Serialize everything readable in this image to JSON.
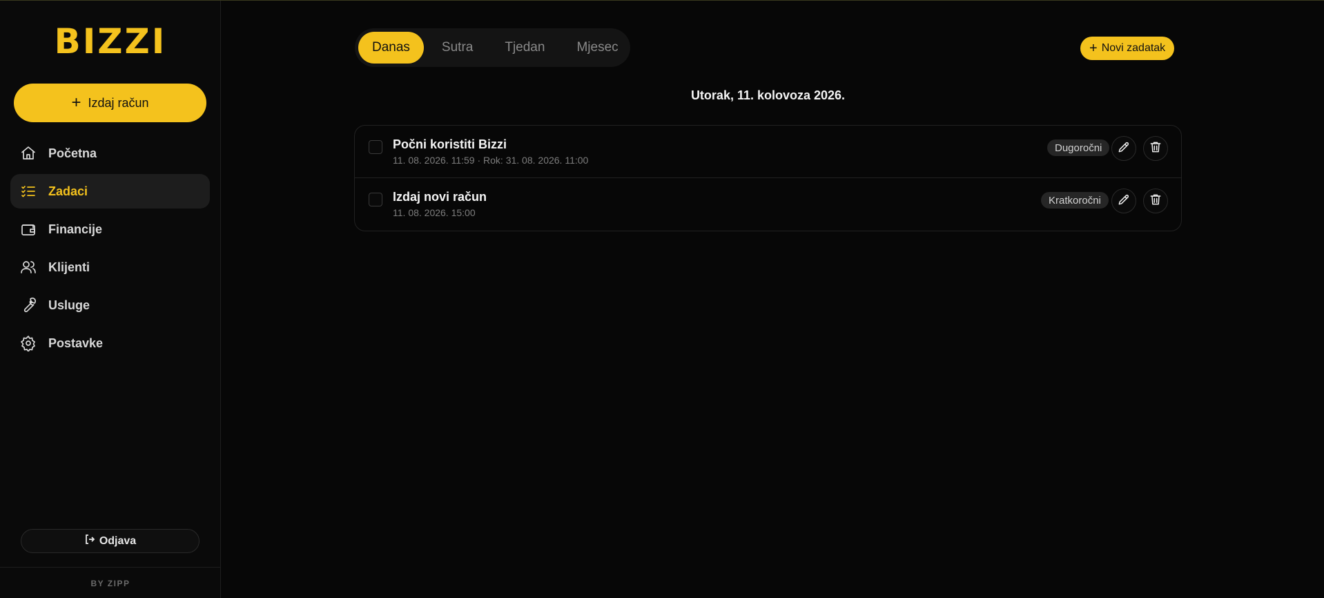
{
  "brand": {
    "logo": "BIZZI",
    "footer": "BY ZIPP"
  },
  "sidebar": {
    "issue_button": "Izdaj račun",
    "items": [
      {
        "label": "Početna",
        "icon": "home-icon",
        "active": false
      },
      {
        "label": "Zadaci",
        "icon": "checklist-icon",
        "active": true
      },
      {
        "label": "Financije",
        "icon": "wallet-icon",
        "active": false
      },
      {
        "label": "Klijenti",
        "icon": "users-icon",
        "active": false
      },
      {
        "label": "Usluge",
        "icon": "wrench-icon",
        "active": false
      },
      {
        "label": "Postavke",
        "icon": "gear-icon",
        "active": false
      }
    ],
    "logout": "Odjava"
  },
  "tabs": [
    {
      "label": "Danas",
      "active": true
    },
    {
      "label": "Sutra",
      "active": false
    },
    {
      "label": "Tjedan",
      "active": false
    },
    {
      "label": "Mjesec",
      "active": false
    }
  ],
  "header": {
    "new_task": "Novi zadatak"
  },
  "date_title": "Utorak, 11. kolovoza 2026.",
  "tasks": [
    {
      "title": "Počni koristiti Bizzi",
      "meta": "11. 08. 2026. 11:59 · Rok: 31. 08. 2026. 11:00",
      "badge": "Dugoročni"
    },
    {
      "title": "Izdaj novi račun",
      "meta": "11. 08. 2026. 15:00",
      "badge": "Kratkoročni"
    }
  ],
  "colors": {
    "accent": "#f4c21d",
    "background": "#070707",
    "sidebar": "#0a0a0a"
  }
}
